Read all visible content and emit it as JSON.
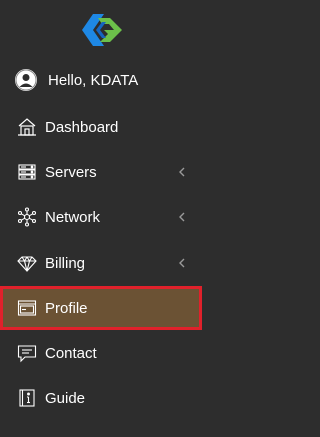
{
  "brand": {
    "logo_icon": "kdata-logo",
    "colors": {
      "blue": "#1e88e5",
      "green": "#6cc04a",
      "accent_active": "#6b5234",
      "highlight_border": "#e0212b",
      "background": "#2d2d2d"
    }
  },
  "user": {
    "greeting": "Hello, KDATA",
    "avatar_icon": "user-avatar-icon"
  },
  "menu": {
    "items": [
      {
        "label": "Dashboard",
        "icon": "home-icon",
        "has_submenu": false,
        "active": false
      },
      {
        "label": "Servers",
        "icon": "server-icon",
        "has_submenu": true,
        "active": false
      },
      {
        "label": "Network",
        "icon": "network-icon",
        "has_submenu": true,
        "active": false
      },
      {
        "label": "Billing",
        "icon": "diamond-icon",
        "has_submenu": true,
        "active": false
      },
      {
        "label": "Profile",
        "icon": "window-icon",
        "has_submenu": false,
        "active": true
      },
      {
        "label": "Contact",
        "icon": "chat-icon",
        "has_submenu": false,
        "active": false
      },
      {
        "label": "Guide",
        "icon": "info-book-icon",
        "has_submenu": false,
        "active": false
      }
    ]
  }
}
